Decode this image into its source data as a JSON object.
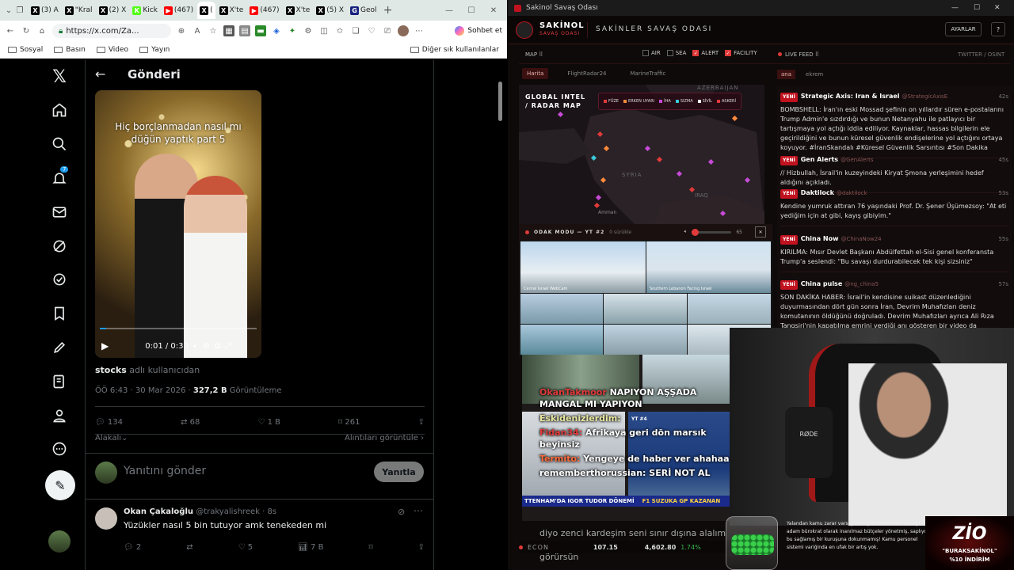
{
  "browser": {
    "tabs": [
      {
        "label": "(3) A",
        "fav": "X",
        "color": "#000"
      },
      {
        "label": "\"Kral",
        "fav": "X",
        "color": "#000"
      },
      {
        "label": "(2) X",
        "fav": "X",
        "color": "#000"
      },
      {
        "label": "Kick",
        "fav": "K",
        "color": "#53fc18"
      },
      {
        "label": "(467)",
        "fav": "▶",
        "color": "#f00"
      },
      {
        "label": "(",
        "fav": "X",
        "color": "#000"
      },
      {
        "label": "X'te",
        "fav": "X",
        "color": "#000"
      },
      {
        "label": "(467)",
        "fav": "▶",
        "color": "#f00"
      },
      {
        "label": "X'te",
        "fav": "X",
        "color": "#000"
      },
      {
        "label": "(5) X",
        "fav": "X",
        "color": "#000"
      },
      {
        "label": "Geol",
        "fav": "G",
        "color": "#1a237e"
      }
    ],
    "url": "https://x.com/Za...",
    "copilot_label": "Sohbet et",
    "bookmarks": [
      "Sosyal",
      "Basın",
      "Video",
      "Yayın"
    ],
    "other_bookmarks": "Diğer sık kullanılanlar"
  },
  "x": {
    "page_title": "Gönderi",
    "notif_count": "7",
    "video_caption_line1": "Hiç borçlanmadan nasıl mı",
    "video_caption_line2": "düğün yaptık part 5",
    "video_time": "0:01 / 0:30",
    "source_user": "stocks",
    "source_suffix": " adlı kullanıcıdan",
    "post_time": "ÖÖ 6:43 · 30 Mar 2026 · ",
    "views_count": "327,2 B",
    "views_label": " Görüntüleme",
    "stats": {
      "replies": "134",
      "reposts": "68",
      "likes": "1 B",
      "bookmarks": "261"
    },
    "sort_label": "Alakalı",
    "quotes_link": "Alıntıları görüntüle",
    "reply_placeholder": "Yanıtını gönder",
    "reply_button": "Yanıtla",
    "reply": {
      "name": "Okan Çakaloğlu",
      "handle": "@trakyalishreek",
      "time": "· 8s",
      "text": "Yüzükler nasıl 5 bin tutuyor amk tenekeden mi",
      "replies": "2",
      "likes": "5",
      "views": "7 B"
    }
  },
  "warroom": {
    "window_title": "Sakinol Savaş Odası",
    "brand_top": "SAKİNOL",
    "brand_bottom": "SAVAŞ ODASI",
    "room_title": "SAKİNLER SAVAŞ ODASI",
    "settings_button": "AYARLAR",
    "help_button": "?",
    "map_label": "MAP ⠿",
    "filters": [
      {
        "label": "AIR",
        "checked": false
      },
      {
        "label": "SEA",
        "checked": false
      },
      {
        "label": "ALERT",
        "checked": true
      },
      {
        "label": "FACILITY",
        "checked": true
      }
    ],
    "live_feed_label": "LIVE FEED ⠿",
    "feed_source": "TWITTER / OSINT",
    "map_tabs": [
      "Harita",
      "FlightRadar24",
      "MarineTraffic"
    ],
    "feed_tabs": [
      "ana",
      "ekrem"
    ],
    "map_title_line1": "GLOBAL INTEL",
    "map_title_line2": "/ RADAR MAP",
    "legend": [
      "FÜZE",
      "ERKEN UYARI",
      "İHA",
      "SIZMA",
      "SİVİL",
      "ASKERİ"
    ],
    "map_places": [
      "AZERBAIJAN",
      "SYRIA",
      "IRAQ",
      "Amman"
    ],
    "new_badge": "YENİ",
    "feed": [
      {
        "name": "Strategic Axis: Iran & Israel",
        "handle": "@StrategicAxisE",
        "age": "42s",
        "text": "BOMBSHELL: İran'ın eski Mossad şefinin on yıllardır süren e-postalarını Trump Admin'e sızdırdığı ve bunun Netanyahu ile patlayıcı bir tartışmaya yol açtığı iddia ediliyor. Kaynaklar, hassas bilgilerin ele geçirildiğini ve bunun küresel güvenlik endişelerine yol açtığını ortaya koyuyor. #İranSkandalı #Küresel Güvenlik Sarsıntısı #Son Dakika"
      },
      {
        "name": "Gen Alerts",
        "handle": "@GenAlerts",
        "age": "45s",
        "text": "// Hizbullah, İsrail'in kuzeyindeki Kiryat Şmona yerleşimini hedef aldığını açıkladı."
      },
      {
        "name": "Daktilock",
        "handle": "@daktilock",
        "age": "53s",
        "text": "Kendine yumruk attıran 76 yaşındaki Prof. Dr. Şener Üşümezsoy: \"At eti yediğim için at gibi, kayış gibiyim.\""
      },
      {
        "name": "China Now",
        "handle": "@ChinaNow24",
        "age": "55s",
        "text": "KIRILMA: Mısır Devlet Başkanı Abdülfettah el-Sisi genel konferansta Trump'a seslendi: \"Bu savaşı durdurabilecek tek kişi sizsiniz\""
      },
      {
        "name": "China pulse",
        "handle": "@ng_china5",
        "age": "57s",
        "text": "SON DAKİKA HABER: İsrail'in kendisine suikast düzenlediğini duyurmasından dört gün sonra İran, Devrim Muhafızları deniz komutanının öldüğünü doğruladı. Devrim Muhafızları ayrıca Ali Rıza Tangsiri'nin kapatılma emrini verdiği anı gösteren bir video da yayınladı."
      }
    ],
    "focus_title": "ODAK MODU — YT #2",
    "focus_sub": "0 sürükle",
    "focus_volume": "65",
    "cam_labels": [
      "Cenral Israel WebCam",
      "Southern Lebanon Facing Israel"
    ],
    "stream_overlay": [
      {
        "who": "OkanTakmoor",
        "text": "NAPIYON AŞŞADA MANGAL MI YAPIYON"
      },
      {
        "who": "Eskidenizlerdim:",
        "text": ""
      },
      {
        "who": "Fidan34:",
        "text": "Afrikaya geri dön marsık beyinsiz"
      },
      {
        "who": "Termito:",
        "text": "Yengeye de haber ver ahahaa"
      },
      {
        "who": "rememberthorussian:",
        "text": "SERİ NOT AL"
      }
    ],
    "yt_label": "YT #4",
    "news_ticker_1": "TTENHAM'DA IGOR TUDOR DÖNEMİ",
    "news_ticker_2": "F1 SUZUKA GP KAZANAN",
    "chat_bottom": "diyo zenci kardeşim seni sınır dışına alalım ki kendinize görülen gördüğü muameleyi görürsün",
    "econ_label": "ECON",
    "econ_1": "107.15",
    "econ_2": "4,602.80",
    "econ_3": "1.74%",
    "promo_text": "Yalandan kamu zarar varsayımlarıyla itham eden sanayi adam bürokrat olarak inanılmaz bütçeler yönetmiş, saplıyor bu sağlamış bir kuruşuna dokunmamış! Kamu personel sistemi variğinda en ufak bir artış yok.",
    "sponsor_brand": "ZİO",
    "sponsor_code": "\"BURAKSAKİNOL\"",
    "sponsor_discount": "%10 İNDİRİM"
  }
}
